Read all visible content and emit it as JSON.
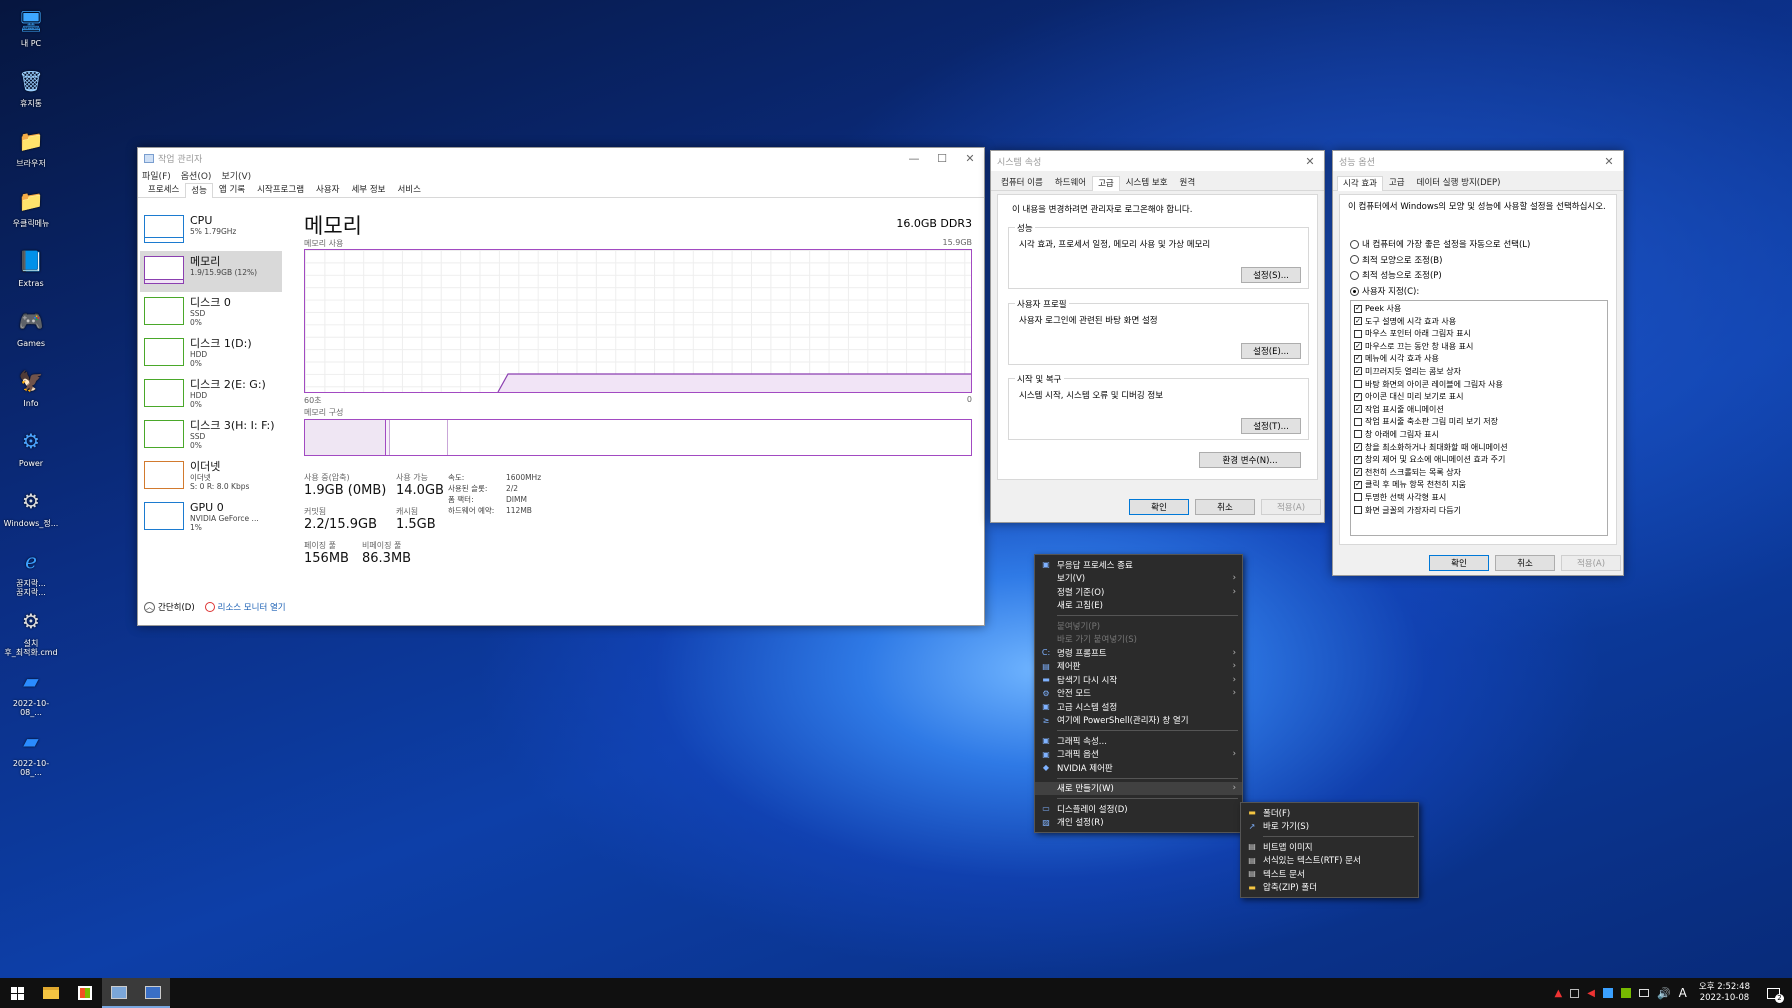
{
  "desktop": {
    "icons": [
      {
        "label": "내 PC",
        "icon": "monitor-icon",
        "glyph": "🖥",
        "color": "#3ea8ff"
      },
      {
        "label": "휴지통",
        "icon": "recycle-bin-icon",
        "glyph": "🗑",
        "color": "#9bd0ff"
      },
      {
        "label": "브라우저",
        "icon": "folder-icon",
        "glyph": "📁",
        "color": "#f4c542"
      },
      {
        "label": "우클릭메뉴",
        "icon": "folder-icon",
        "glyph": "📁",
        "color": "#f4c542"
      },
      {
        "label": "Extras",
        "icon": "book-icon",
        "glyph": "📘",
        "color": "#8aa4c8"
      },
      {
        "label": "Games",
        "icon": "gamepad-icon",
        "glyph": "🎮",
        "color": "#ffffff"
      },
      {
        "label": "Info",
        "icon": "phoenix-icon",
        "glyph": "🦅",
        "color": "#ff7a2a"
      },
      {
        "label": "Power",
        "icon": "power-icon",
        "glyph": "⚙",
        "color": "#4aa3ff"
      },
      {
        "label": "Windows_정...",
        "icon": "settings-file-icon",
        "glyph": "⚙",
        "color": "#dddddd"
      },
      {
        "label": "꿈지락...\n꿈지락...",
        "icon": "ie-icon",
        "glyph": "ℯ",
        "color": "#3aa0ff"
      },
      {
        "label": "설치\n후_최적화.cmd",
        "icon": "cmd-file-icon",
        "glyph": "⚙",
        "color": "#dddddd"
      },
      {
        "label": "2022-10-08_...",
        "icon": "screenshot-icon",
        "glyph": "▰",
        "color": "#2a8cff"
      },
      {
        "label": "2022-10-08_...",
        "icon": "screenshot-icon",
        "glyph": "▰",
        "color": "#2a8cff"
      }
    ]
  },
  "taskmgr": {
    "title": "작업 관리자",
    "menu": [
      "파일(F)",
      "옵션(O)",
      "보기(V)"
    ],
    "tabs": [
      "프로세스",
      "성능",
      "앱 기록",
      "시작프로그램",
      "사용자",
      "세부 정보",
      "서비스"
    ],
    "active_tab": 1,
    "sidebar": [
      {
        "name": "CPU",
        "sub1": "5% 1.79GHz",
        "sub2": "",
        "sub3": "",
        "color": "#1c7bd0"
      },
      {
        "name": "메모리",
        "sub1": "1.9/15.9GB (12%)",
        "sub2": "",
        "sub3": "",
        "color": "#8b3fb0"
      },
      {
        "name": "디스크 0",
        "sub1": "SSD",
        "sub2": "0%",
        "sub3": "",
        "color": "#4aa82a"
      },
      {
        "name": "디스크 1(D:)",
        "sub1": "HDD",
        "sub2": "0%",
        "sub3": "",
        "color": "#4aa82a"
      },
      {
        "name": "디스크 2(E: G:)",
        "sub1": "HDD",
        "sub2": "0%",
        "sub3": "",
        "color": "#4aa82a"
      },
      {
        "name": "디스크 3(H: I: F:)",
        "sub1": "SSD",
        "sub2": "0%",
        "sub3": "",
        "color": "#4aa82a"
      },
      {
        "name": "이더넷",
        "sub1": "이더넷",
        "sub2": "S: 0 R: 8.0 Kbps",
        "sub3": "",
        "color": "#d27a2e"
      },
      {
        "name": "GPU 0",
        "sub1": "NVIDIA GeForce ...",
        "sub2": "1%",
        "sub3": "",
        "color": "#1c7bd0"
      }
    ],
    "main": {
      "heading": "메모리",
      "spec": "16.0GB DDR3",
      "usage_label": "메모리 사용",
      "usage_max": "15.9GB",
      "time_left": "60초",
      "time_right": "0",
      "composition_label": "메모리 구성",
      "stats": {
        "in_use_label": "사용 중(압축)",
        "in_use": "1.9GB (0MB)",
        "available_label": "사용 가능",
        "available": "14.0GB",
        "committed_label": "커밋됨",
        "committed": "2.2/15.9GB",
        "cached_label": "캐시됨",
        "cached": "1.5GB",
        "paged_label": "페이징 풀",
        "paged": "156MB",
        "nonpaged_label": "비페이징 풀",
        "nonpaged": "86.3MB"
      },
      "details": [
        {
          "k": "속도:",
          "v": "1600MHz"
        },
        {
          "k": "사용된 슬롯:",
          "v": "2/2"
        },
        {
          "k": "폼 팩터:",
          "v": "DIMM"
        },
        {
          "k": "하드웨어 예약:",
          "v": "112MB"
        }
      ]
    },
    "footer": {
      "less": "간단히(D)",
      "monitor": "리소스 모니터 열기"
    }
  },
  "sysprop": {
    "title": "시스템 속성",
    "tabs": [
      "컴퓨터 이름",
      "하드웨어",
      "고급",
      "시스템 보호",
      "원격"
    ],
    "active_tab": 2,
    "admin_note": "이 내용을 변경하려면 관리자로 로그온해야 합니다.",
    "perf_title": "성능",
    "perf_desc": "시각 효과, 프로세서 일정, 메모리 사용 및 가상 메모리",
    "perf_btn": "설정(S)...",
    "profile_title": "사용자 프로필",
    "profile_desc": "사용자 로그인에 관련된 바탕 화면 설정",
    "profile_btn": "설정(E)...",
    "startup_title": "시작 및 복구",
    "startup_desc": "시스템 시작, 시스템 오류 및 디버깅 정보",
    "startup_btn": "설정(T)...",
    "env_btn": "환경 변수(N)...",
    "ok": "확인",
    "cancel": "취소",
    "apply": "적용(A)"
  },
  "perfopt": {
    "title": "성능 옵션",
    "tabs": [
      "시각 효과",
      "고급",
      "데이터 실행 방지(DEP)"
    ],
    "active_tab": 0,
    "desc": "이 컴퓨터에서 Windows의 모양 및 성능에 사용할 설정을 선택하십시오.",
    "radios": [
      {
        "label": "내 컴퓨터에 가장 좋은 설정을 자동으로 선택(L)",
        "on": false
      },
      {
        "label": "최적 모양으로 조정(B)",
        "on": false
      },
      {
        "label": "최적 성능으로 조정(P)",
        "on": false
      },
      {
        "label": "사용자 지정(C):",
        "on": true
      }
    ],
    "checks": [
      {
        "label": "Peek 사용",
        "on": true
      },
      {
        "label": "도구 설명에 시각 효과 사용",
        "on": true
      },
      {
        "label": "마우스 포인터 아래 그림자 표시",
        "on": false
      },
      {
        "label": "마우스로 끄는 동안 창 내용 표시",
        "on": true
      },
      {
        "label": "메뉴에 시각 효과 사용",
        "on": true
      },
      {
        "label": "미끄러지듯 열리는 콤보 상자",
        "on": true
      },
      {
        "label": "바탕 화면의 아이콘 레이블에 그림자 사용",
        "on": false
      },
      {
        "label": "아이콘 대신 미리 보기로 표시",
        "on": true
      },
      {
        "label": "작업 표시줄 애니메이션",
        "on": true
      },
      {
        "label": "작업 표시줄 축소판 그림 미리 보기 저장",
        "on": false
      },
      {
        "label": "창 아래에 그림자 표시",
        "on": false
      },
      {
        "label": "창을 최소화하거나 최대화할 때 애니메이션",
        "on": true
      },
      {
        "label": "창의 제어 및 요소에 애니메이션 효과 주기",
        "on": true
      },
      {
        "label": "천천히 스크롤되는 목록 상자",
        "on": true
      },
      {
        "label": "클릭 후 메뉴 항목 천천히 지움",
        "on": true
      },
      {
        "label": "투명한 선택 사각형 표시",
        "on": false
      },
      {
        "label": "화면 글꼴의 가장자리 다듬기",
        "on": false
      }
    ],
    "ok": "확인",
    "cancel": "취소",
    "apply": "적용(A)"
  },
  "context_menu": [
    {
      "label": "무응답 프로세스 종료",
      "icon": "end-task-icon",
      "glyph": "▣",
      "arrow": false,
      "dis": false,
      "hl": false
    },
    {
      "label": "보기(V)",
      "icon": "",
      "glyph": "",
      "arrow": true,
      "dis": false,
      "hl": false
    },
    {
      "label": "정렬 기준(O)",
      "icon": "",
      "glyph": "",
      "arrow": true,
      "dis": false,
      "hl": false
    },
    {
      "label": "새로 고침(E)",
      "icon": "",
      "glyph": "",
      "arrow": false,
      "dis": false,
      "hl": false
    },
    {
      "sep": true
    },
    {
      "label": "붙여넣기(P)",
      "icon": "",
      "glyph": "",
      "arrow": false,
      "dis": true,
      "hl": false
    },
    {
      "label": "바로 가기 붙여넣기(S)",
      "icon": "",
      "glyph": "",
      "arrow": false,
      "dis": true,
      "hl": false
    },
    {
      "label": "명령 프롬프트",
      "icon": "cmd-icon",
      "glyph": "C:",
      "arrow": true,
      "dis": false,
      "hl": false
    },
    {
      "label": "제어판",
      "icon": "control-panel-icon",
      "glyph": "▤",
      "arrow": true,
      "dis": false,
      "hl": false
    },
    {
      "label": "탐색기 다시 시작",
      "icon": "explorer-icon",
      "glyph": "▬",
      "arrow": true,
      "dis": false,
      "hl": false
    },
    {
      "label": "안전 모드",
      "icon": "gear-icon",
      "glyph": "⚙",
      "arrow": true,
      "dis": false,
      "hl": false
    },
    {
      "label": "고급 시스템 설정",
      "icon": "system-icon",
      "glyph": "▣",
      "arrow": false,
      "dis": false,
      "hl": false
    },
    {
      "label": "여기에 PowerShell(관리자) 창 열기",
      "icon": "powershell-icon",
      "glyph": "≥",
      "arrow": false,
      "dis": false,
      "hl": false
    },
    {
      "sep": true
    },
    {
      "label": "그래픽 속성...",
      "icon": "graphics-icon",
      "glyph": "▣",
      "arrow": false,
      "dis": false,
      "hl": false
    },
    {
      "label": "그래픽 옵션",
      "icon": "graphics-icon",
      "glyph": "▣",
      "arrow": true,
      "dis": false,
      "hl": false
    },
    {
      "label": "NVIDIA 제어판",
      "icon": "nvidia-icon",
      "glyph": "◆",
      "arrow": false,
      "dis": false,
      "hl": false
    },
    {
      "sep": true
    },
    {
      "label": "새로 만들기(W)",
      "icon": "",
      "glyph": "",
      "arrow": true,
      "dis": false,
      "hl": true
    },
    {
      "sep": true
    },
    {
      "label": "디스플레이 설정(D)",
      "icon": "display-icon",
      "glyph": "▭",
      "arrow": false,
      "dis": false,
      "hl": false
    },
    {
      "label": "개인 설정(R)",
      "icon": "personalize-icon",
      "glyph": "▨",
      "arrow": false,
      "dis": false,
      "hl": false
    }
  ],
  "submenu": [
    {
      "label": "폴더(F)",
      "icon": "folder-icon",
      "glyph": "▬",
      "color": "#f4c542"
    },
    {
      "label": "바로 가기(S)",
      "icon": "shortcut-icon",
      "glyph": "↗",
      "color": "#7fb2ff"
    },
    {
      "sep": true
    },
    {
      "label": "비트맵 이미지",
      "icon": "bitmap-icon",
      "glyph": "▤",
      "color": "#cfcfcf"
    },
    {
      "label": "서식있는 텍스트(RTF) 문서",
      "icon": "rtf-icon",
      "glyph": "▤",
      "color": "#cfcfcf"
    },
    {
      "label": "텍스트 문서",
      "icon": "text-doc-icon",
      "glyph": "▤",
      "color": "#cfcfcf"
    },
    {
      "label": "압축(ZIP) 폴더",
      "icon": "zip-folder-icon",
      "glyph": "▬",
      "color": "#f4c542"
    }
  ],
  "taskbar": {
    "time": "오후 2:52:48",
    "date": "2022-10-08",
    "ime": "A",
    "notif": "2"
  }
}
